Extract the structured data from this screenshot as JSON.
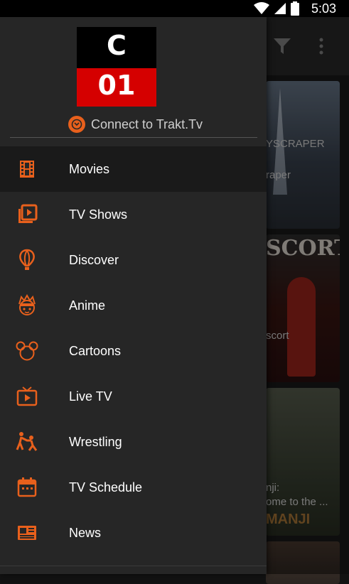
{
  "status_bar": {
    "time": "5:03"
  },
  "drawer": {
    "logo": {
      "top_text": "C",
      "bottom_text": "01"
    },
    "trakt_label": "Connect to Trakt.Tv",
    "items": [
      {
        "label": "Movies",
        "icon": "film-icon",
        "active": true
      },
      {
        "label": "TV Shows",
        "icon": "tv-shows-icon"
      },
      {
        "label": "Discover",
        "icon": "balloon-icon"
      },
      {
        "label": "Anime",
        "icon": "anime-icon"
      },
      {
        "label": "Cartoons",
        "icon": "mouse-ears-icon"
      },
      {
        "label": "Live TV",
        "icon": "live-tv-icon"
      },
      {
        "label": "Wrestling",
        "icon": "wrestling-icon"
      },
      {
        "label": "TV Schedule",
        "icon": "calendar-icon"
      },
      {
        "label": "News",
        "icon": "news-icon"
      }
    ]
  },
  "background_cards": [
    {
      "line1": "YSCRAPER",
      "line2": "raper"
    },
    {
      "line1": "SCORT",
      "line2": "scort"
    },
    {
      "line1": "nji:",
      "line2": "ome to the ...",
      "line3": "MANJI"
    }
  ],
  "colors": {
    "accent": "#e8601c",
    "drawer_bg": "#262626",
    "logo_red": "#d50000"
  }
}
